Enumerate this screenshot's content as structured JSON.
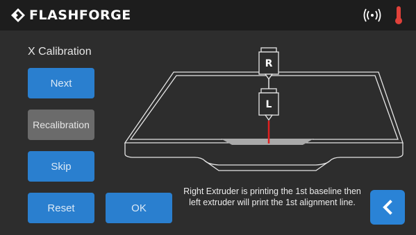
{
  "header": {
    "brand": "FLASHFORGE",
    "icons": [
      "flashforge-logo-icon",
      "wifi-icon",
      "temperature-warning-icon"
    ]
  },
  "screen": {
    "title": "X Calibration",
    "buttons": {
      "next": "Next",
      "recalibration": "Recalibration",
      "skip": "Skip",
      "reset": "Reset",
      "ok": "OK"
    },
    "diagram": {
      "right_extruder_label": "R",
      "left_extruder_label": "L"
    },
    "message": "Right Extruder is printing the 1st baseline then left extruder will print the 1st alignment line.",
    "back_icon": "chevron-left-icon"
  },
  "colors": {
    "primary_button": "#2a7fcf",
    "disabled_button": "#6b6b6b",
    "background": "#2d2d2d",
    "topbar": "#1d1d1d",
    "alignment_line": "#e02020",
    "temperature_icon": "#e0413a"
  }
}
